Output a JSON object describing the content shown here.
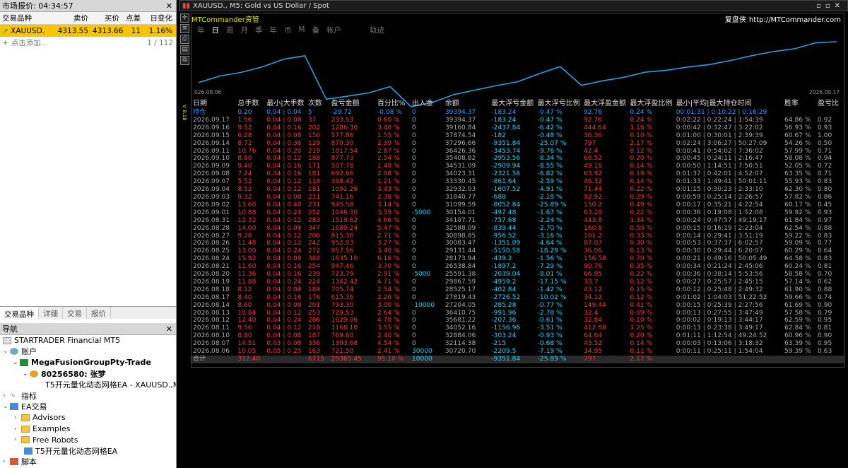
{
  "market": {
    "title": "市场报价: 04:34:57",
    "headers": [
      "交易品种",
      "卖价",
      "买价",
      "点差",
      "日变化"
    ],
    "row": {
      "symbol": "XAUUSD.",
      "bid": "4313.55",
      "ask": "4313.66",
      "spread": "11",
      "change": "1.16%"
    },
    "add_label": "点击添加...",
    "count": "1 / 112"
  },
  "tabs": [
    "交易品种",
    "详细",
    "交易",
    "报价"
  ],
  "navigator": {
    "title": "导航",
    "items": [
      "STARTRADER Financial MT5",
      "账户",
      "MegaFusionGroupPty-Trade",
      "80256580: 张梦",
      "T5开元量化动态网格EA - XAUUSD.,M",
      "指标",
      "EA交易",
      "Advisors",
      "Examples",
      "Free Robots",
      "T5开元量化动态网格EA",
      "脚本"
    ]
  },
  "chart": {
    "title": "XAUUSD., M5: Gold vs US Dollar / Spot",
    "brand": "MTCommander资管",
    "share_label": "复盘侠",
    "site": "http://MTCommander.com",
    "periods": [
      "年",
      "日",
      "周",
      "月",
      "季",
      "年",
      "币",
      "M",
      "备",
      "帐户",
      "轨迹"
    ],
    "eq_start": "026.08.06",
    "eq_end": "2026.09.17",
    "side_label": "V 8.18"
  },
  "table": {
    "headers": [
      "日期",
      "总手数",
      "最小|大手数",
      "次数",
      "盈亏金额",
      "百分比%",
      "出入金",
      "余额",
      "最大浮亏金额",
      "最大浮亏比例",
      "最大浮盈金额",
      "最大浮盈比例",
      "最小|平均|最大持仓时间",
      "胜率",
      "盈亏比"
    ],
    "current": [
      "持仓",
      "0.20",
      "0.04 | 0.04",
      "5",
      "-29.72",
      "-0.08 %",
      "0",
      "39394.37",
      "-183.24",
      "-0.47 %",
      "92.76",
      "0.24 %",
      "00:01:31 | 0:10:22 | 0:16:29",
      "",
      ""
    ],
    "rows": [
      [
        "2026.09.17",
        "1.56",
        "0.04 | 0.08",
        "37",
        "233.53",
        "0.60 %",
        "0",
        "39394.37",
        "-183.24",
        "-0.47 %",
        "92.76",
        "0.24 %",
        "0:02:22 | 0:22:24 | 1:54:39",
        "64.86 %",
        "0.92"
      ],
      [
        "2026.09.16",
        "9.52",
        "0.04 | 0.16",
        "202",
        "1286.30",
        "3.40 %",
        "0",
        "39160.84",
        "-2437.84",
        "-6.42 %",
        "444.64",
        "1.16 %",
        "0:00:42 | 0:32:47 | 3:22:02",
        "56.93 %",
        "0.93"
      ],
      [
        "2026.09.15",
        "6.28",
        "0.04 | 0.08",
        "150",
        "577.86",
        "1.55 %",
        "0",
        "37874.54",
        "-182",
        "-0.48 %",
        "36.36",
        "0.10 %",
        "0:01:00 | 0:30:01 | 2:39:39",
        "60.67 %",
        "1.00"
      ],
      [
        "2026.09.14",
        "8.72",
        "0.04 | 0.36",
        "129",
        "870.30",
        "2.39 %",
        "0",
        "37296.66",
        "-9351.84",
        "-25.07 %",
        "797",
        "2.17 %",
        "0:02:24 | 3:06:27 | 50:27:09",
        "54.26 %",
        "0.50"
      ],
      [
        "2026.09.11",
        "10.76",
        "0.04 | 0.20",
        "219",
        "1017.54",
        "2.87 %",
        "0",
        "36426.36",
        "-3453.74",
        "-9.76 %",
        "42.4",
        "0.12 %",
        "0:00:41 | 0:54:02 | 7:36:02",
        "57.99 %",
        "0.71"
      ],
      [
        "2026.09.10",
        "8.80",
        "0.04 | 0.12",
        "188",
        "877.73",
        "2.54 %",
        "0",
        "35408.82",
        "-2953.56",
        "-8.34 %",
        "68.52",
        "0.20 %",
        "0:00:45 | 0:24:11 | 2:16:47",
        "58.08 %",
        "0.94"
      ],
      [
        "2026.09.09",
        "9.40",
        "0.04 | 0.16",
        "171",
        "507.78",
        "1.49 %",
        "0",
        "34531.09",
        "-2909.94",
        "-8.55 %",
        "49.16",
        "0.14 %",
        "0:00:50 | 1:14:51 | 7:50:51",
        "52.05 %",
        "0.72"
      ],
      [
        "2026.09.08",
        "7.24",
        "0.04 | 0.16",
        "181",
        "692.66",
        "2.08 %",
        "0",
        "34023.31",
        "-2321.56",
        "-6.82 %",
        "63.92",
        "0.19 %",
        "0:01:37 | 0:42:01 | 4:52:07",
        "63.35 %",
        "0.71"
      ],
      [
        "2026.09.07",
        "5.52",
        "0.04 | 0.12",
        "118",
        "398.42",
        "1.21 %",
        "0",
        "33330.45",
        "-861.64",
        "-2.59 %",
        "46.32",
        "0.14 %",
        "0:01:33 | 1:49:41 | 50:01:11",
        "55.93 %",
        "0.83"
      ],
      [
        "2026.09.04",
        "8.52",
        "0.04 | 0.12",
        "181",
        "1091.26",
        "3.43 %",
        "0",
        "32932.03",
        "-1607.52",
        "-4.91 %",
        "71.44",
        "0.22 %",
        "0:01:15 | 0:30:23 | 2:33:10",
        "62.30 %",
        "0.80"
      ],
      [
        "2026.09.03",
        "9.32",
        "0.04 | 0.08",
        "211",
        "741.16",
        "2.38 %",
        "0",
        "31840.77",
        "-688",
        "-2.18 %",
        "92.92",
        "0.29 %",
        "0:00:59 | 0:25:14 | 2:26:57",
        "57.82 %",
        "0.86"
      ],
      [
        "2026.09.02",
        "13.60",
        "0.04 | 0.40",
        "231",
        "945.58",
        "3.14 %",
        "0",
        "31099.59",
        "-8052.84",
        "-25.89 %",
        "150.2",
        "0.49 %",
        "0:00:17 | 0:35:21 | 4:22:54",
        "60.17 %",
        "0.45"
      ],
      [
        "2026.09.01",
        "10.88",
        "0.04 | 0.24",
        "252",
        "1046.30",
        "3.59 %",
        "-5000",
        "30154.01",
        "-497.48",
        "-1.67 %",
        "63.28",
        "0.22 %",
        "0:00:36 | 0:19:08 | 1:52:08",
        "59.92 %",
        "0.93"
      ],
      [
        "2026.08.31",
        "12.32",
        "0.04 | 0.12",
        "283",
        "1519.62",
        "4.66 %",
        "0",
        "34107.71",
        "-757.68",
        "-2.24 %",
        "443.8",
        "1.34 %",
        "0:00:24 | 0:47:57 | 49:19:17",
        "61.84 %",
        "0.97"
      ],
      [
        "2026.08.28",
        "14.60",
        "0.04 | 0.08",
        "347",
        "1689.24",
        "5.47 %",
        "0",
        "32588.09",
        "-839.44",
        "-2.70 %",
        "160.8",
        "0.50 %",
        "0:00:15 | 0:16:19 | 2:23:04",
        "62.54 %",
        "0.88"
      ],
      [
        "2026.08.27",
        "9.28",
        "0.04 | 0.12",
        "206",
        "815.30",
        "2.71 %",
        "0",
        "30898.85",
        "-956.52",
        "-3.16 %",
        "101.2",
        "0.33 %",
        "0:00:14 | 0:29:41 | 3:51:19",
        "59.22 %",
        "0.83"
      ],
      [
        "2026.08.26",
        "11.48",
        "0.04 | 0.12",
        "242",
        "952.03",
        "3.27 %",
        "0",
        "30083.47",
        "-1351.09",
        "-4.64 %",
        "87.07",
        "0.30 %",
        "0:00:53 | 0:37:37 | 6:02:57",
        "59.09 %",
        "0.77"
      ],
      [
        "2026.08.25",
        "13.00",
        "0.04 | 0.24",
        "272",
        "957.56",
        "3.40 %",
        "0",
        "29131.44",
        "-5150.58",
        "-18.29 %",
        "36.06",
        "0.13 %",
        "0:00:30 | 0:29:44 | 6:20:07",
        "60.29 %",
        "0.64"
      ],
      [
        "2026.08.24",
        "15.92",
        "0.04 | 0.08",
        "384",
        "1635.10",
        "6.16 %",
        "0",
        "28173.94",
        "-439.2",
        "-1.56 %",
        "156.58",
        "0.70 %",
        "0:00:21 | 0:49:16 | 50:05:49",
        "64.58 %",
        "0.83"
      ],
      [
        "2026.08.21",
        "11.60",
        "0.04 | 0.16",
        "254",
        "947.46",
        "3.70 %",
        "0",
        "26538.84",
        "-1897.2",
        "-7.29 %",
        "90.76",
        "0.35 %",
        "0:00:34 | 0:21:24 | 2:45:06",
        "60.24 %",
        "0.81"
      ],
      [
        "2026.08.20",
        "11.36",
        "0.04 | 0.16",
        "239",
        "723.79",
        "2.91 %",
        "-5000",
        "25591.38",
        "-2039.04",
        "-8.01 %",
        "66.95",
        "0.22 %",
        "0:00:36 | 0:38:14 | 5:53:56",
        "58.58 %",
        "0.70"
      ],
      [
        "2026.08.19",
        "11.88",
        "0.04 | 0.24",
        "224",
        "1342.42",
        "4.71 %",
        "0",
        "29867.59",
        "-4959.2",
        "-17.15 %",
        "33.7",
        "0.12 %",
        "0:00:27 | 0:25:57 | 2:45:15",
        "57.14 %",
        "0.62"
      ],
      [
        "2026.08.18",
        "8.12",
        "0.04 | 0.08",
        "189",
        "705.74",
        "2.54 %",
        "0",
        "28525.17",
        "-402.84",
        "-1.42 %",
        "43.12",
        "0.15 %",
        "0:00:12 | 0:25:48 | 2:49:32",
        "61.90 %",
        "0.88"
      ],
      [
        "2026.08.17",
        "8.40",
        "0.04 | 0.16",
        "176",
        "615.36",
        "2.26 %",
        "0",
        "27819.43",
        "-2726.52",
        "-10.02 %",
        "34.12",
        "0.12 %",
        "0:01:02 | 1:04:03 | 51:22:52",
        "59.66 %",
        "0.74"
      ],
      [
        "2026.08.14",
        "8.60",
        "0.04 | 0.08",
        "201",
        "793.30",
        "3.00 %",
        "-10000",
        "27204.05",
        "-285.28",
        "-0.77 %",
        "149.44",
        "0.41 %",
        "0:00:15 | 0:25:39 | 2:27:56",
        "61.69 %",
        "0.90"
      ],
      [
        "2026.08.13",
        "10.84",
        "0.04 | 0.12",
        "253",
        "729.53",
        "2.64 %",
        "0",
        "36410.75",
        "-991.96",
        "-2.78 %",
        "32.4",
        "0.09 %",
        "0:00:13 | 0:27:55 | 3:47:49",
        "57.58 %",
        "0.79"
      ],
      [
        "2026.08.12",
        "12.40",
        "0.04 | 0.24",
        "286",
        "1629.06",
        "4.78 %",
        "0",
        "35681.22",
        "-207.36",
        "-0.61 %",
        "32.84",
        "0.10 %",
        "0:00:02 | 0:19:13 | 3:44:17",
        "62.59 %",
        "0.95"
      ],
      [
        "2026.08.11",
        "9.56",
        "0.04 | 0.12",
        "218",
        "1168.10",
        "3.55 %",
        "0",
        "34052.16",
        "-1156.96",
        "-3.51 %",
        "412.68",
        "1.25 %",
        "0:00:13 | 0:23:38 | 3:49:17",
        "62.84 %",
        "0.81"
      ],
      [
        "2026.08.10",
        "8.80",
        "0.04 | 0.08",
        "187",
        "769.60",
        "2.40 %",
        "0",
        "32884.06",
        "-303.24",
        "-0.93 %",
        "64.64",
        "0.20 %",
        "0:01:11 | 1:12:54 | 49:24:52",
        "60.96 %",
        "0.90"
      ],
      [
        "2026.08.07",
        "14.51",
        "0.03 | 0.08",
        "336",
        "1393.68",
        "4.54 %",
        "0",
        "32114.38",
        "-215",
        "-0.68 %",
        "43.52",
        "0.14 %",
        "0:00:03 | 0:13:06 | 3:18:32",
        "63.39 %",
        "0.95"
      ],
      [
        "2026.08.06",
        "10.05",
        "0.05 | 0.25",
        "163",
        "721.50",
        "2.41 %",
        "30000",
        "30720.70",
        "-2209.5",
        "-7.19 %",
        "34.95",
        "0.11 %",
        "0:00:11 | 0:25:11 | 1:54:04",
        "59.39 %",
        "0.63"
      ]
    ],
    "total": [
      "合计",
      "312.40",
      "",
      "6715",
      "29365.45",
      "95.10 %",
      "10000",
      "",
      "-9351.84",
      "-25.89 %",
      "797",
      "2.17 %",
      "",
      "",
      ""
    ]
  },
  "colors": {
    "equity": "#1aa3e8",
    "select": "#f9c500",
    "brand": "#e8e800"
  }
}
